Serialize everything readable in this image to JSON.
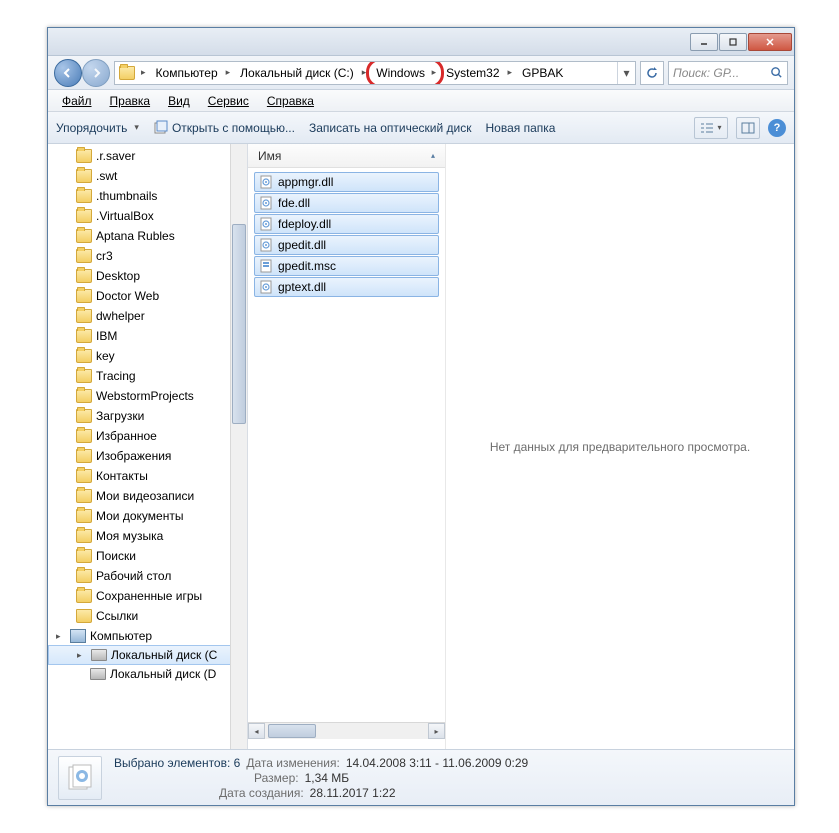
{
  "titlebar": {
    "min": "–",
    "max": "□",
    "close": "×"
  },
  "breadcrumb": {
    "segments": [
      "Компьютер",
      "Локальный диск (C:)",
      "Windows",
      "System32",
      "GPBAK"
    ]
  },
  "search": {
    "placeholder": "Поиск: GP..."
  },
  "menubar": [
    "Файл",
    "Правка",
    "Вид",
    "Сервис",
    "Справка"
  ],
  "toolbar": {
    "organize": "Упорядочить",
    "openwith": "Открыть с помощью...",
    "burn": "Записать на оптический диск",
    "newfolder": "Новая папка"
  },
  "sidebar": {
    "items": [
      {
        "label": ".r.saver",
        "icon": "folder"
      },
      {
        "label": ".swt",
        "icon": "folder"
      },
      {
        "label": ".thumbnails",
        "icon": "folder"
      },
      {
        "label": ".VirtualBox",
        "icon": "folder"
      },
      {
        "label": "Aptana Rubles",
        "icon": "folder"
      },
      {
        "label": "cr3",
        "icon": "folder"
      },
      {
        "label": "Desktop",
        "icon": "folder"
      },
      {
        "label": "Doctor Web",
        "icon": "folder"
      },
      {
        "label": "dwhelper",
        "icon": "folder"
      },
      {
        "label": "IBM",
        "icon": "folder"
      },
      {
        "label": "key",
        "icon": "folder"
      },
      {
        "label": "Tracing",
        "icon": "folder"
      },
      {
        "label": "WebstormProjects",
        "icon": "folder"
      },
      {
        "label": "Загрузки",
        "icon": "folder"
      },
      {
        "label": "Избранное",
        "icon": "folder"
      },
      {
        "label": "Изображения",
        "icon": "folder"
      },
      {
        "label": "Контакты",
        "icon": "folder"
      },
      {
        "label": "Мои видеозаписи",
        "icon": "folder"
      },
      {
        "label": "Мои документы",
        "icon": "folder"
      },
      {
        "label": "Моя музыка",
        "icon": "folder"
      },
      {
        "label": "Поиски",
        "icon": "folder"
      },
      {
        "label": "Рабочий стол",
        "icon": "folder"
      },
      {
        "label": "Сохраненные игры",
        "icon": "folder"
      },
      {
        "label": "Ссылки",
        "icon": "link"
      }
    ],
    "computer": "Компьютер",
    "drives": [
      "Локальный диск (C",
      "Локальный диск (D"
    ]
  },
  "filelist": {
    "column": "Имя",
    "files": [
      {
        "name": "appmgr.dll",
        "type": "dll"
      },
      {
        "name": "fde.dll",
        "type": "dll"
      },
      {
        "name": "fdeploy.dll",
        "type": "dll"
      },
      {
        "name": "gpedit.dll",
        "type": "dll"
      },
      {
        "name": "gpedit.msc",
        "type": "msc"
      },
      {
        "name": "gptext.dll",
        "type": "dll"
      }
    ]
  },
  "preview": {
    "empty": "Нет данных для предварительного просмотра."
  },
  "status": {
    "title": "Выбрано элементов: 6",
    "date_label": "Дата изменения:",
    "date_value": "14.04.2008 3:11 - 11.06.2009 0:29",
    "size_label": "Размер:",
    "size_value": "1,34 МБ",
    "created_label": "Дата создания:",
    "created_value": "28.11.2017 1:22"
  }
}
